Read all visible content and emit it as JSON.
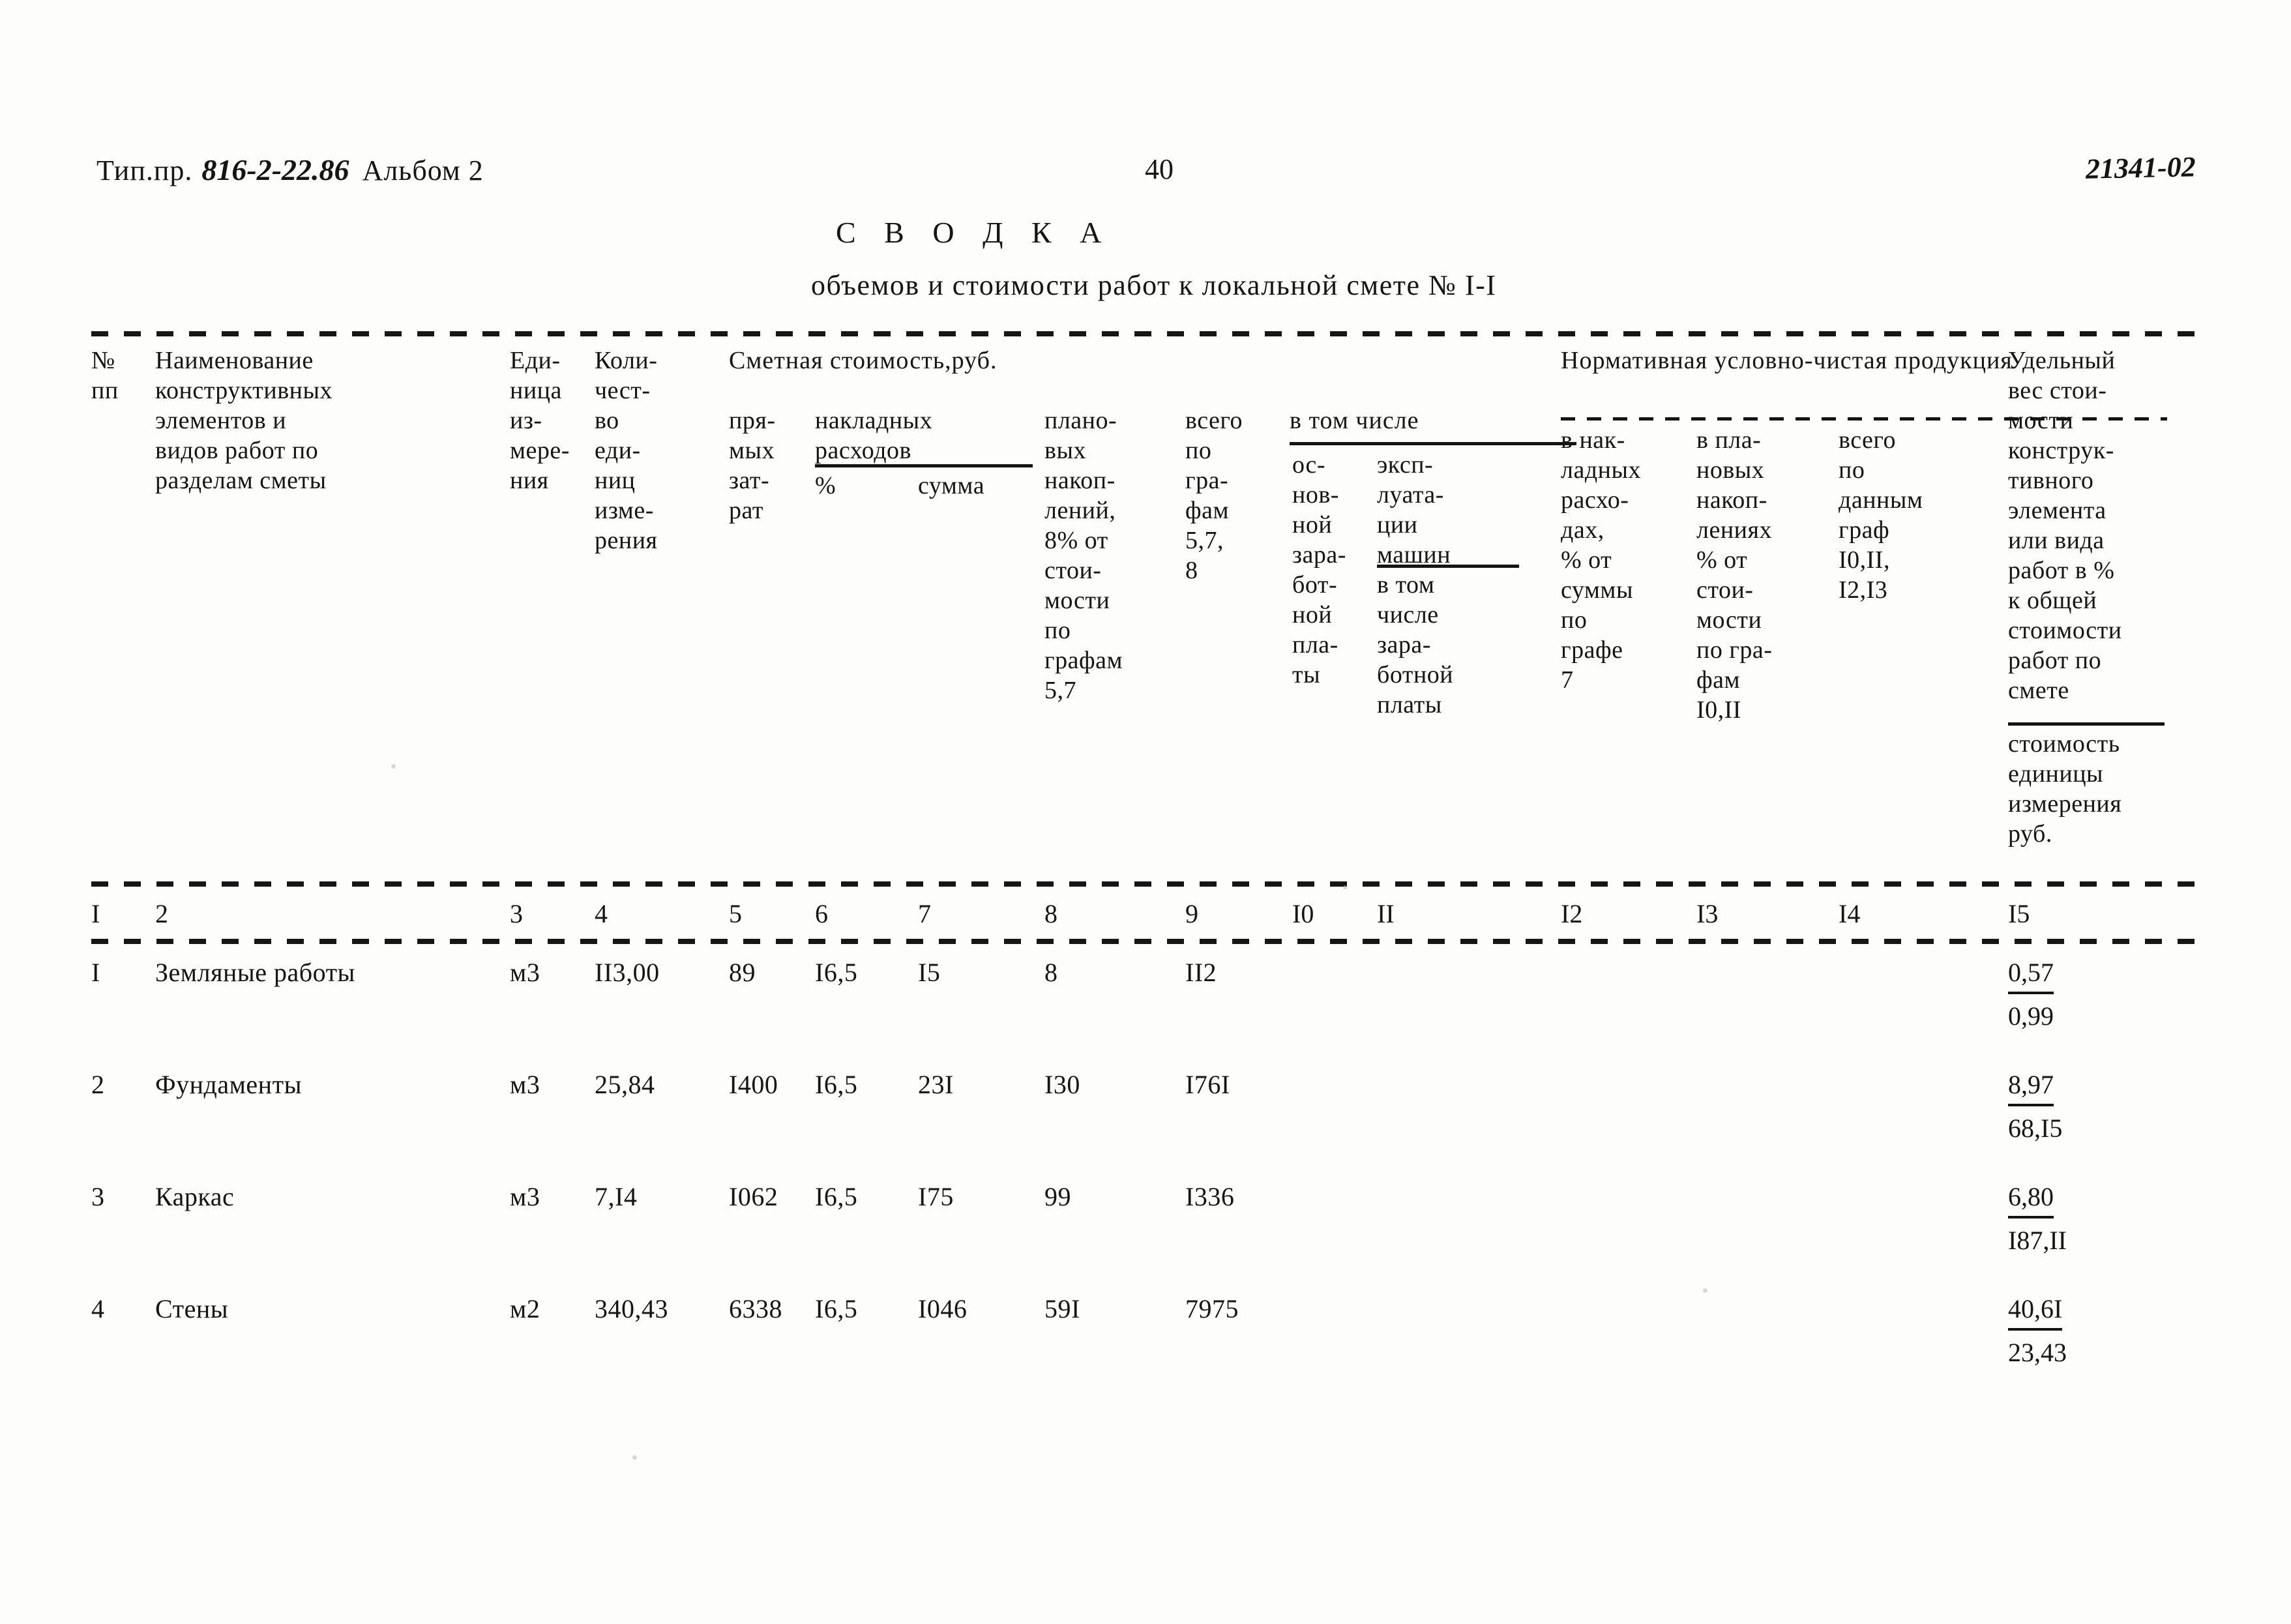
{
  "header": {
    "doc_prefix": "Тип.пр.",
    "project_number": "816-2-22.86",
    "album": "Альбом 2",
    "page_number": "40",
    "sheet_code": "21341-02"
  },
  "title": "С В О Д К А",
  "subtitle": "объемов и стоимости работ к локальной смете № I-I",
  "group_headers": {
    "smetnaya": "Сметная стоимость,руб.",
    "v_tom_chisle": "в том числе",
    "normativnaya": "Нормативная условно-чистая продукция"
  },
  "columns": [
    {
      "no": "I",
      "header": "№\nпп"
    },
    {
      "no": "2",
      "header": "Наименование\nконструктивных\nэлементов и\nвидов работ по\nразделам сметы"
    },
    {
      "no": "3",
      "header": "Еди-\nница\nиз-\nмере-\nния"
    },
    {
      "no": "4",
      "header": "Коли-\nчест-\nво\nеди-\nниц\nизме-\nрения"
    },
    {
      "no": "5",
      "header": "пря-\nмых\nзат-\nрат"
    },
    {
      "no": "6",
      "header": "%"
    },
    {
      "no": "7",
      "header": "сумма"
    },
    {
      "no": "8",
      "header": "плано-\nвых\nнакоп-\nлений,\n8% от\nстои-\nмости\nпо\nграфам\n5,7"
    },
    {
      "no": "9",
      "header": "всего\nпо\nгра-\nфам\n5,7,\n8"
    },
    {
      "no": "I0",
      "header": "ос-\nнов-\nной\nзара-\nбот-\nной\nпла-\nты"
    },
    {
      "no": "II",
      "header": "эксп-\nлуата-\nции\nмашин"
    },
    {
      "no": "I2",
      "header": "в нак-\nладных\nрасхо-\nдах,\n% от\nсуммы\nпо\nграфе\n7"
    },
    {
      "no": "I3",
      "header": "в пла-\nновых\nнакоп-\nлениях\n% от\nстои-\nмости\nпо гра-\nфам\nI0,II"
    },
    {
      "no": "I4",
      "header": "всего\nпо\nданным\nграф\nI0,II,\nI2,I3"
    },
    {
      "no": "I5",
      "header": "Удельный\nвес стои-\nмости\nконструк-\nтивного\nэлемента\nили вида\nработ в %\nк общей\nстоимости\nработ по\nсмете"
    }
  ],
  "sub_headers": {
    "nakladnyh": "накладных\nрасходов",
    "mashin_sub": "в том\nчисле\nзара-\nботной\nплаты",
    "col15_second": "стоимость\nединицы\nизмерения\nруб."
  },
  "rows": [
    {
      "no": "I",
      "name": "Земляные работы",
      "unit": "м3",
      "qty": "II3,00",
      "direct": "89",
      "overhead_pct": "I6,5",
      "overhead_sum": "I5",
      "planned": "8",
      "total": "II2",
      "basic_wage": "",
      "machines": "",
      "nchp_overhead": "",
      "nchp_planned": "",
      "nchp_total": "",
      "share_pct": "0,57",
      "unit_cost": "0,99"
    },
    {
      "no": "2",
      "name": "Фундаменты",
      "unit": "м3",
      "qty": "25,84",
      "direct": "I400",
      "overhead_pct": "I6,5",
      "overhead_sum": "23I",
      "planned": "I30",
      "total": "I76I",
      "basic_wage": "",
      "machines": "",
      "nchp_overhead": "",
      "nchp_planned": "",
      "nchp_total": "",
      "share_pct": "8,97",
      "unit_cost": "68,I5"
    },
    {
      "no": "3",
      "name": "Каркас",
      "unit": "м3",
      "qty": "7,I4",
      "direct": "I062",
      "overhead_pct": "I6,5",
      "overhead_sum": "I75",
      "planned": "99",
      "total": "I336",
      "basic_wage": "",
      "machines": "",
      "nchp_overhead": "",
      "nchp_planned": "",
      "nchp_total": "",
      "share_pct": "6,80",
      "unit_cost": "I87,II"
    },
    {
      "no": "4",
      "name": "Стены",
      "unit": "м2",
      "qty": "340,43",
      "direct": "6338",
      "overhead_pct": "I6,5",
      "overhead_sum": "I046",
      "planned": "59I",
      "total": "7975",
      "basic_wage": "",
      "machines": "",
      "nchp_overhead": "",
      "nchp_planned": "",
      "nchp_total": "",
      "share_pct": "40,6I",
      "unit_cost": "23,43"
    }
  ]
}
